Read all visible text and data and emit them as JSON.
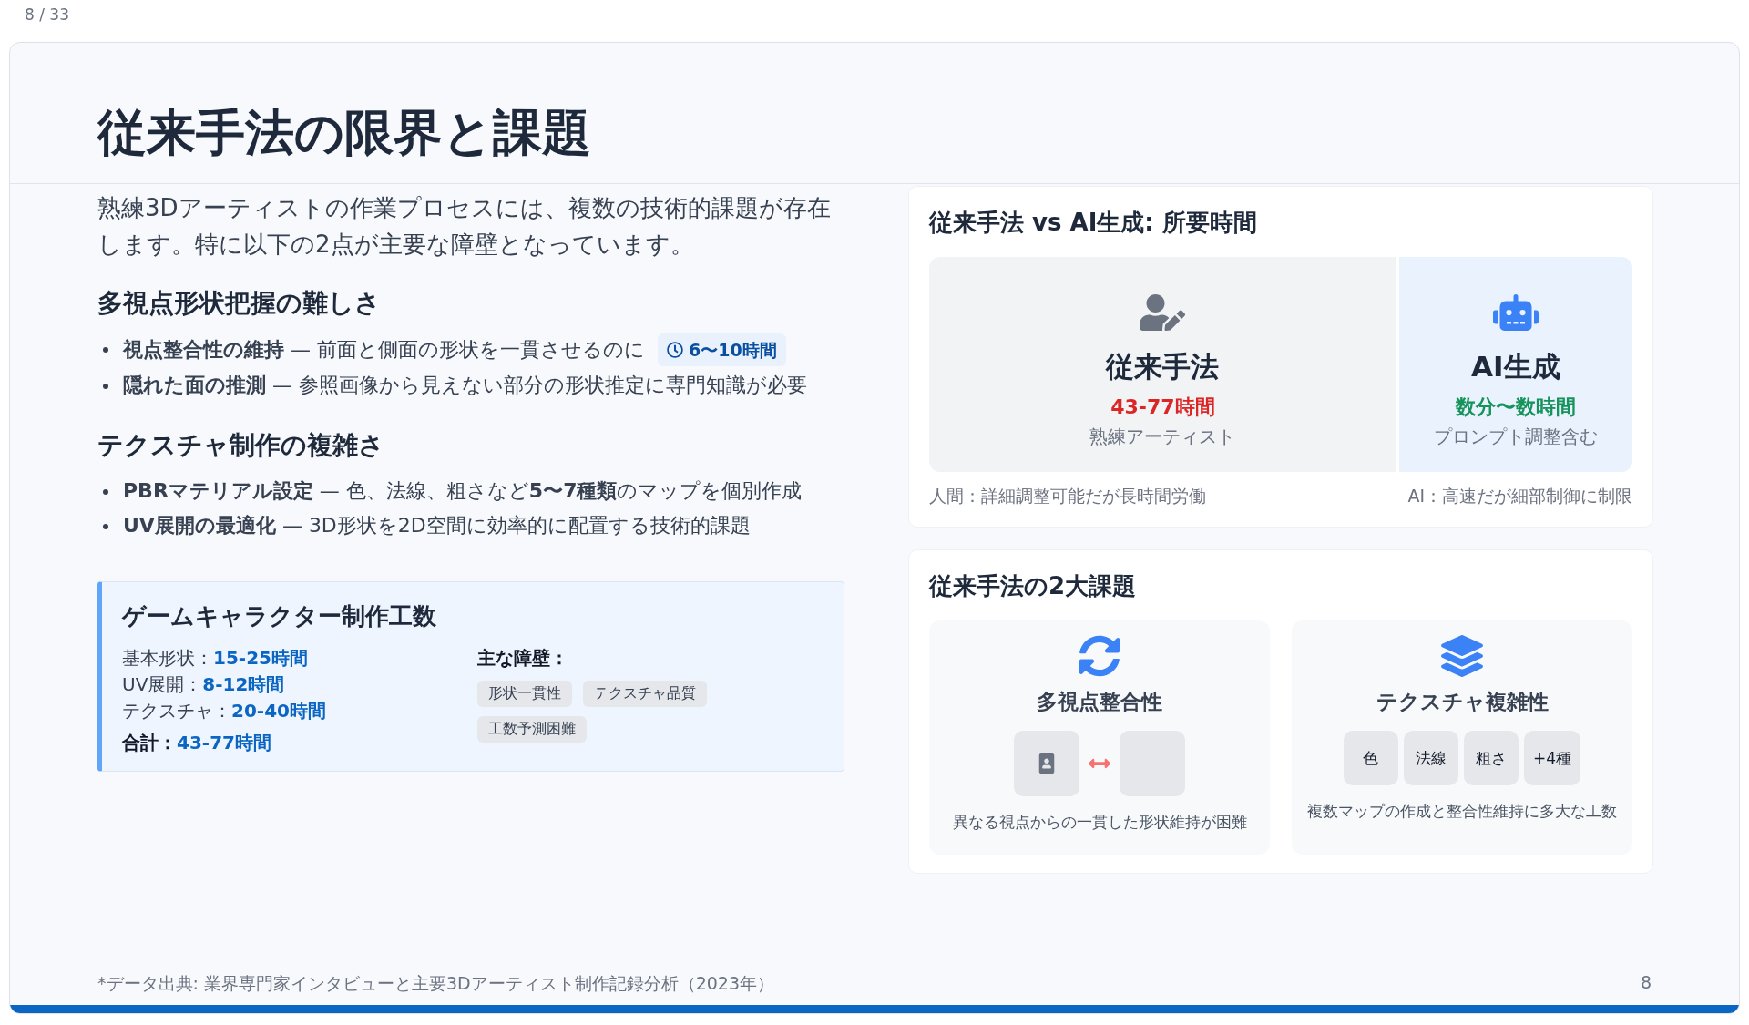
{
  "page_counter": "8 / 33",
  "title": "従来手法の限界と課題",
  "intro": "熟練3Dアーティストの作業プロセスには、複数の技術的課題が存在します。特に以下の2点が主要な障壁となっています。",
  "sections": [
    {
      "heading": "多視点形状把握の難しさ",
      "bullets": [
        {
          "text": "**視点整合性の維持** — 前面と側面の形状を一貫させるのに",
          "badge": "6〜10時間"
        },
        {
          "text": "**隠れた面の推測** — 参照画像から見えない部分の形状推定に専門知識が必要"
        }
      ]
    },
    {
      "heading": "テクスチャ制作の複雑さ",
      "bullets": [
        {
          "text": "**PBRマテリアル設定** — 色、法線、粗さなど**5〜7種類**のマップを個別作成"
        },
        {
          "text": "**UV展開の最適化** — 3D形状を2D空間に効率的に配置する技術的課題"
        }
      ]
    }
  ],
  "workload": {
    "title": "ゲームキャラクター制作工数",
    "items": [
      {
        "label": "基本形状：",
        "value": "15-25時間"
      },
      {
        "label": "UV展開：",
        "value": "8-12時間"
      },
      {
        "label": "テクスチャ：",
        "value": "20-40時間"
      }
    ],
    "total": {
      "label": "合計：",
      "value": "43-77時間"
    },
    "barriers_label": "主な障壁：",
    "barriers": [
      "形状一貫性",
      "テクスチャ品質",
      "工数予測困難"
    ]
  },
  "comparison": {
    "title": "従来手法 vs AI生成: 所要時間",
    "columns": [
      {
        "kind": "human",
        "title": "従来手法",
        "time": "43-77時間",
        "subtitle": "熟練アーティスト"
      },
      {
        "kind": "ai",
        "title": "AI生成",
        "time": "数分〜数時間",
        "subtitle": "プロンプト調整含む"
      }
    ],
    "notes": [
      "人間：詳細調整可能だが長時間労働",
      "AI：高速だが細部制御に制限"
    ]
  },
  "challenges": {
    "title": "従来手法の2大課題",
    "items": [
      {
        "kind": "views",
        "title": "多視点整合性",
        "caption": "異なる視点からの一貫した形状維持が困難"
      },
      {
        "kind": "texture",
        "title": "テクスチャ複雑性",
        "chips": [
          "色",
          "法線",
          "粗さ",
          "+4種"
        ],
        "caption": "複数マップの作成と整合性維持に多大な工数"
      }
    ]
  },
  "footer": {
    "source": "*データ出典: 業界専門家インタビューと主要3Dアーティスト制作記録分析（2023年）",
    "page_number": "8"
  }
}
